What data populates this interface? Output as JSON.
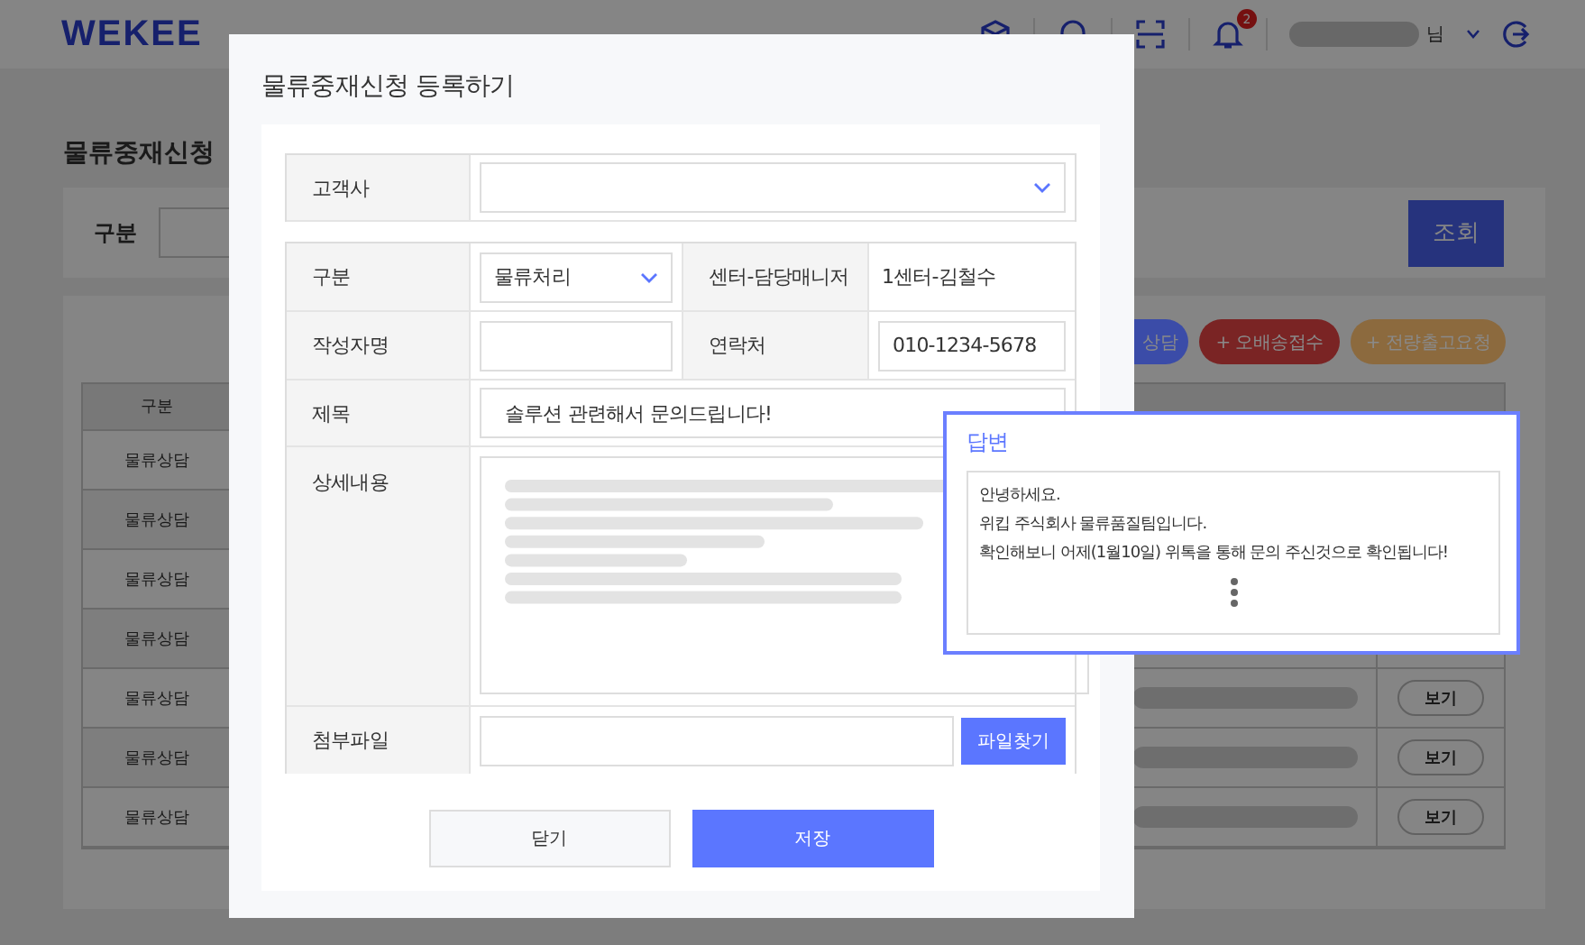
{
  "header": {
    "logo": "WEKEE",
    "notification_count": "2",
    "user_suffix": "님"
  },
  "page": {
    "title": "물류중재신청",
    "filter": {
      "label": "구분",
      "search_button": "조회"
    },
    "actions": [
      {
        "label": "상담",
        "color": "#3b4ca8"
      },
      {
        "label": "+ 오배송접수",
        "color": "#7a2424"
      },
      {
        "label": "+ 전량출고요청",
        "color": "#8c6a3e"
      }
    ],
    "table": {
      "columns": [
        "구분"
      ],
      "rows": [
        {
          "category": "물류상담"
        },
        {
          "category": "물류상담"
        },
        {
          "category": "물류상담"
        },
        {
          "category": "물류상담"
        },
        {
          "category": "물류상담",
          "view_button": "보기"
        },
        {
          "category": "물류상담",
          "view_button": "보기"
        },
        {
          "category": "물류상담",
          "view_button": "보기"
        }
      ]
    }
  },
  "modal": {
    "title": "물류중재신청 등록하기",
    "customer": {
      "label": "고객사"
    },
    "category": {
      "label": "구분",
      "value": "물류처리"
    },
    "manager": {
      "label": "센터-담당매니저",
      "value": "1센터-김철수"
    },
    "author": {
      "label": "작성자명"
    },
    "contact": {
      "label": "연락처",
      "value": "010-1234-5678"
    },
    "subject": {
      "label": "제목",
      "value": "솔루션 관련해서 문의드립니다!"
    },
    "details": {
      "label": "상세내용"
    },
    "attachment": {
      "label": "첨부파일",
      "button": "파일찾기"
    },
    "buttons": [
      {
        "label": "닫기",
        "kind": "secondary"
      },
      {
        "label": "저장",
        "kind": "primary"
      }
    ]
  },
  "answer": {
    "title": "답변",
    "lines": [
      "안녕하세요.",
      "위킵 주식회사 물류품질팀입니다.",
      "확인해보니 어제(1월10일) 위톡을 통해 문의 주신것으로 확인됩니다!"
    ]
  }
}
